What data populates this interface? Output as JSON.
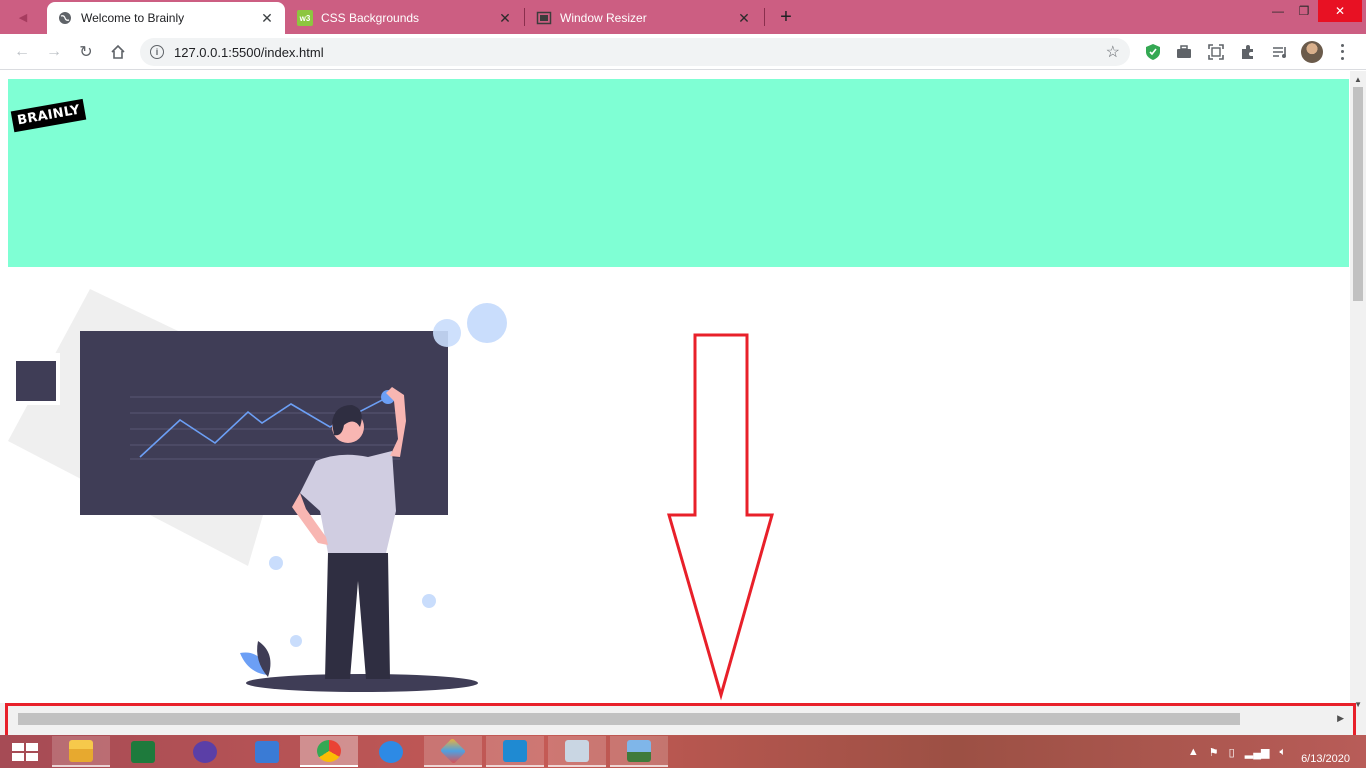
{
  "browser": {
    "tabs": [
      {
        "title": "Welcome to Brainly",
        "active": true,
        "icon": "globe-icon"
      },
      {
        "title": "CSS Backgrounds",
        "active": false,
        "icon": "w3schools-icon"
      },
      {
        "title": "Window Resizer",
        "active": false,
        "icon": "resizer-icon"
      }
    ],
    "address": {
      "url": "127.0.0.1:5500/index.html"
    }
  },
  "page": {
    "hero_color": "#7fffd4",
    "logo_text": "BRAINLY"
  },
  "annotations": {
    "color": "#e8202a"
  },
  "taskbar": {
    "apps": [
      "file-explorer-icon",
      "excel-icon",
      "settings-icon",
      "control-panel-icon",
      "chrome-icon",
      "cloud-icon",
      "maps-icon",
      "vscode-icon",
      "monitor-icon",
      "photos-icon"
    ],
    "clock": {
      "date": "6/13/2020"
    }
  }
}
